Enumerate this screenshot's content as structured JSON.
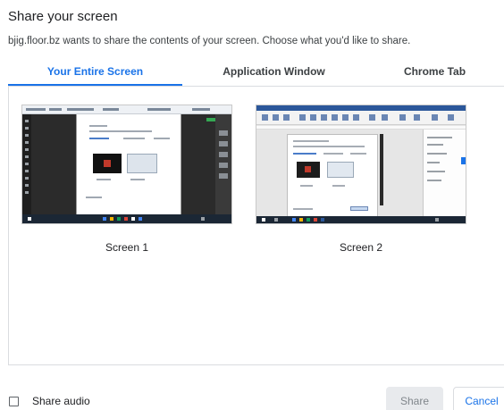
{
  "dialog": {
    "title": "Share your screen",
    "subtitle": "bjig.floor.bz wants to share the contents of your screen. Choose what you'd like to share."
  },
  "tabs": [
    {
      "label": "Your Entire Screen",
      "active": true
    },
    {
      "label": "Application Window",
      "active": false
    },
    {
      "label": "Chrome Tab",
      "active": false
    }
  ],
  "screens": [
    {
      "label": "Screen 1"
    },
    {
      "label": "Screen 2"
    }
  ],
  "footer": {
    "share_audio_label": "Share audio",
    "share_audio_checked": false,
    "share_button": "Share",
    "share_button_enabled": false,
    "cancel_button": "Cancel"
  },
  "colors": {
    "accent": "#1a73e8",
    "disabled_button_bg": "#e8eaed",
    "disabled_button_text": "#80868b",
    "divider": "#dadce0"
  }
}
